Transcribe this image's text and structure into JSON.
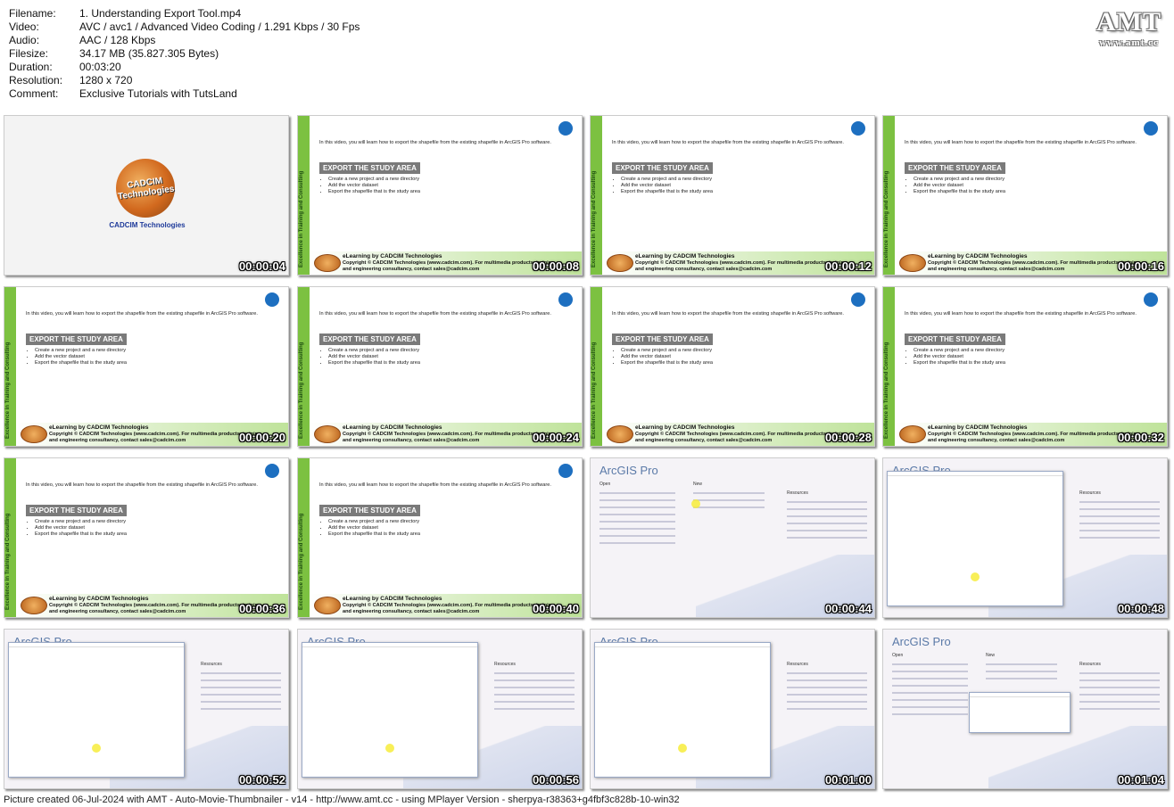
{
  "meta": {
    "rows": [
      {
        "key": "Filename:",
        "value": "1. Understanding Export Tool.mp4"
      },
      {
        "key": "Video:",
        "value": "AVC / avc1 / Advanced Video Coding / 1.291 Kbps / 30 Fps"
      },
      {
        "key": "Audio:",
        "value": "AAC / 128 Kbps"
      },
      {
        "key": "Filesize:",
        "value": "34.17 MB (35.827.305 Bytes)"
      },
      {
        "key": "Duration:",
        "value": "00:03:20"
      },
      {
        "key": "Resolution:",
        "value": "1280 x 720"
      },
      {
        "key": "Comment:",
        "value": "Exclusive Tutorials with TutsLand"
      }
    ]
  },
  "logo": {
    "text": "AMT",
    "url": "www.amt.cc"
  },
  "slide": {
    "intro": "In this video, you will learn how to export the shapefile from the existing shapefile in ArcGIS Pro software.",
    "header": "EXPORT THE STUDY AREA",
    "bullets": [
      "Create a new project and a new directory",
      "Add the vector dataset",
      "Export the shapefile that is the study area"
    ],
    "side": "Excellence in Training and Consulting",
    "elearn": "eLearning by CADCIM Technologies",
    "copyright": "Copyright © CADCIM Technologies (www.cadcim.com). For multimedia products, training, and engineering consultancy, contact sales@cadcim.com"
  },
  "intro": {
    "disc": "CADCIM Technologies",
    "brand": "CADCIM Technologies"
  },
  "arcgis": {
    "title": "ArcGIS Pro",
    "open": "Open",
    "new": "New",
    "resources": "Resources"
  },
  "thumbs": [
    {
      "type": "intro",
      "time": "00:00:04"
    },
    {
      "type": "slide",
      "time": "00:00:08"
    },
    {
      "type": "slide",
      "time": "00:00:12"
    },
    {
      "type": "slide",
      "time": "00:00:16"
    },
    {
      "type": "slide",
      "time": "00:00:20"
    },
    {
      "type": "slide",
      "time": "00:00:24"
    },
    {
      "type": "slide",
      "time": "00:00:28"
    },
    {
      "type": "slide",
      "time": "00:00:32"
    },
    {
      "type": "slide",
      "time": "00:00:36"
    },
    {
      "type": "slide",
      "time": "00:00:40"
    },
    {
      "type": "arc",
      "time": "00:00:44"
    },
    {
      "type": "arc-dialog",
      "time": "00:00:48"
    },
    {
      "type": "arc-dialog",
      "time": "00:00:52"
    },
    {
      "type": "arc-dialog",
      "time": "00:00:56"
    },
    {
      "type": "arc-dialog",
      "time": "00:01:00"
    },
    {
      "type": "arc-small",
      "time": "00:01:04"
    }
  ],
  "footer": "Picture created 06-Jul-2024 with AMT - Auto-Movie-Thumbnailer - v14 - http://www.amt.cc - using MPlayer Version - sherpya-r38363+g4fbf3c828b-10-win32"
}
